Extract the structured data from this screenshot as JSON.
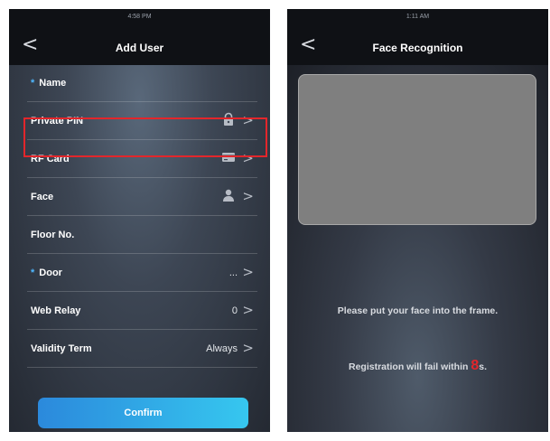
{
  "left": {
    "status_time": "4:58 PM",
    "title": "Add User",
    "back_glyph": "<",
    "rows": [
      {
        "label": "Name",
        "required": "*",
        "value": "",
        "icon": "",
        "chevron": ""
      },
      {
        "label": "Private PIN",
        "required": "",
        "value": "",
        "icon": "lock-icon",
        "chevron": ">"
      },
      {
        "label": "RF Card",
        "required": "",
        "value": "",
        "icon": "card-icon",
        "chevron": ">"
      },
      {
        "label": "Face",
        "required": "",
        "value": "",
        "icon": "person-icon",
        "chevron": ">"
      },
      {
        "label": "Floor No.",
        "required": "",
        "value": "",
        "icon": "",
        "chevron": ""
      },
      {
        "label": "Door",
        "required": "*",
        "value": "...",
        "icon": "",
        "chevron": ">"
      },
      {
        "label": "Web Relay",
        "required": "",
        "value": "0",
        "icon": "",
        "chevron": ">"
      },
      {
        "label": "Validity Term",
        "required": "",
        "value": "Always",
        "icon": "",
        "chevron": ">"
      }
    ],
    "confirm_label": "Confirm"
  },
  "right": {
    "status_time": "1:11 AM",
    "title": "Face Recognition",
    "back_glyph": "<",
    "instruction": "Please put your face into the frame.",
    "fail_prefix": "Registration will fail within ",
    "countdown": "8",
    "fail_suffix": "s."
  },
  "colors": {
    "accent_blue": "#2b89dc",
    "required_star": "#4fb8ff",
    "highlight_red": "#e3262b"
  }
}
